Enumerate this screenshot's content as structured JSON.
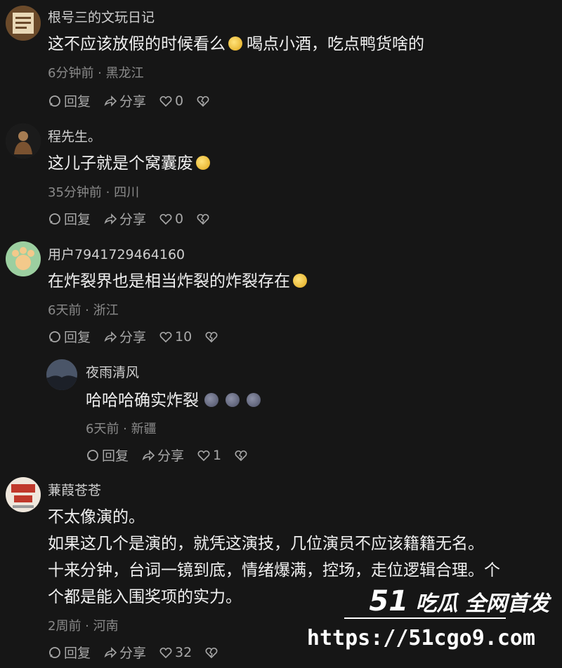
{
  "actions": {
    "reply": "回复",
    "share": "分享"
  },
  "comments": [
    {
      "name": "根号三的文玩日记",
      "text": "这不应该放假的时候看么",
      "text_after": "喝点小酒，吃点鸭货啥的",
      "meta": "6分钟前 · 黑龙江",
      "likes": "0"
    },
    {
      "name": "程先生。",
      "text": "这儿子就是个窝囊废",
      "meta": "35分钟前 · 四川",
      "likes": "0"
    },
    {
      "name": "用户7941729464160",
      "text": "在炸裂界也是相当炸裂的炸裂存在",
      "meta": "6天前 · 浙江",
      "likes": "10"
    },
    {
      "name": "夜雨清风",
      "text": "哈哈哈确实炸裂",
      "meta": "6天前 · 新疆",
      "likes": "1"
    },
    {
      "name": "蒹葭苍苍",
      "lines": [
        "不太像演的。",
        "如果这几个是演的，就凭这演技，几位演员不应该籍籍无名。",
        "十来分钟，台词一镜到底，情绪爆满，控场，走位逻辑合理。个",
        "个都是能入围奖项的实力。"
      ],
      "meta": "2周前 · 河南",
      "likes": "32"
    }
  ],
  "watermark": {
    "logo_number": "51",
    "logo_text": "吃瓜 全网首发",
    "url": "https://51cgo9.com"
  },
  "colors": {
    "background": "#161616",
    "text": "#f0f0f0",
    "meta": "#8a8a8a"
  }
}
